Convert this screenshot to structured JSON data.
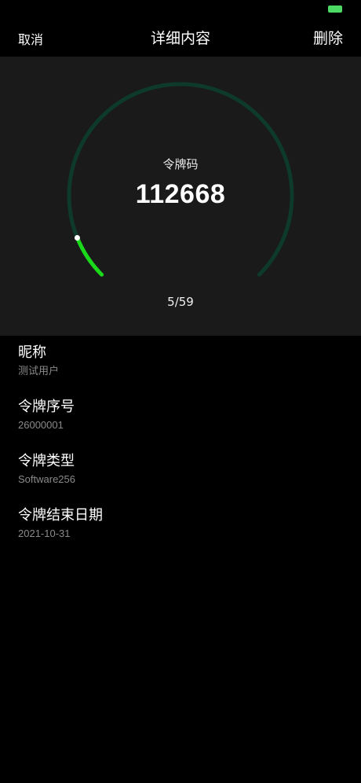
{
  "nav": {
    "cancel_label": "取消",
    "title": "详细内容",
    "delete_label": "删除"
  },
  "token": {
    "label": "令牌码",
    "code": "112668",
    "counter": "5/59",
    "progress": {
      "current": 5,
      "total": 59
    }
  },
  "colors": {
    "ring_track": "#0d3a2a",
    "ring_progress": "#1bd81b",
    "panel_bg": "#1a1a1a",
    "battery": "#4cd964"
  },
  "details": [
    {
      "label": "昵称",
      "value": "测试用户"
    },
    {
      "label": "令牌序号",
      "value": "26000001"
    },
    {
      "label": "令牌类型",
      "value": "Software256"
    },
    {
      "label": "令牌结束日期",
      "value": "2021-10-31"
    }
  ]
}
